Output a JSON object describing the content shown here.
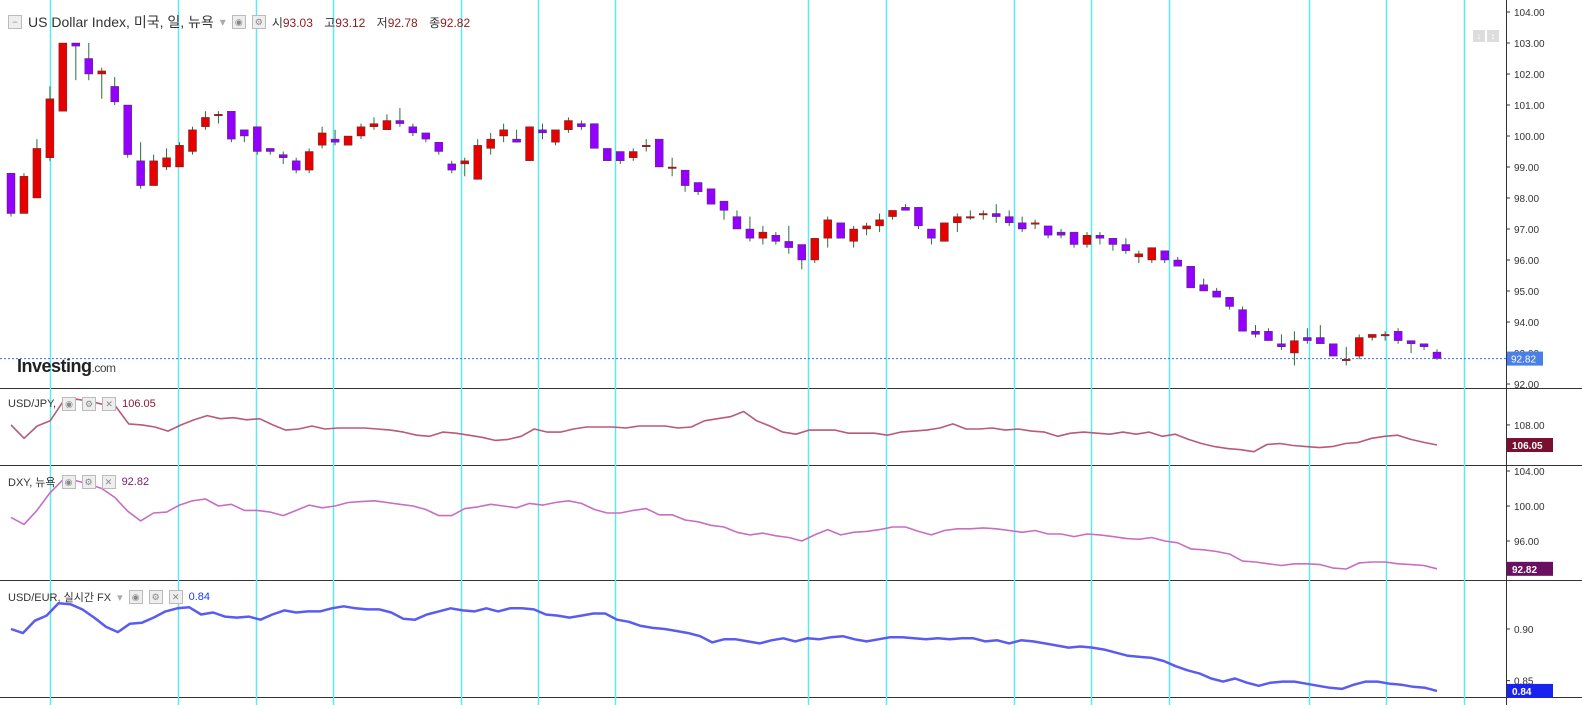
{
  "main": {
    "title": "US Dollar Index, 미국, 일, 뉴욕",
    "ohlc": [
      {
        "k": "시",
        "v": "93.03"
      },
      {
        "k": "고",
        "v": "93.12"
      },
      {
        "k": "저",
        "v": "92.78"
      },
      {
        "k": "종",
        "v": "92.82"
      }
    ],
    "last_label": "92.82",
    "logo_main": "Investing",
    "logo_suffix": ".com"
  },
  "panels": [
    {
      "title": "USD/JPY,",
      "value": "106.05",
      "value_color": "#8b1a3a",
      "last_label": "106.05",
      "label_bg": "#7a1030"
    },
    {
      "title": "DXY, 뉴욕",
      "value": "92.82",
      "value_color": "#7a1a6a",
      "last_label": "92.82",
      "label_bg": "#6b1060"
    },
    {
      "title": "USD/EUR, 실시간 FX",
      "value": "0.84",
      "value_color": "#1a3aff",
      "last_label": "0.84",
      "label_bg": "#1a22ee"
    }
  ],
  "colors": {
    "up": "#e60000",
    "down": "#9400ff",
    "wick": "#2c6e3c",
    "cyan_line": "#5ee8f0",
    "usdjpy": "#b85a78",
    "dxy": "#c86ec2",
    "usdeur": "#5a5cf0",
    "grid": "#eeeeee"
  },
  "chart_data": [
    {
      "type": "candlestick",
      "title": "US Dollar Index, 미국, 일, 뉴욕",
      "ylim": [
        92.0,
        104.0
      ],
      "y_ticks": [
        "104.00",
        "103.00",
        "102.00",
        "101.00",
        "100.00",
        "99.00",
        "98.00",
        "97.00",
        "96.00",
        "95.00",
        "94.00",
        "93.00",
        "92.00"
      ],
      "candles": [
        [
          98.8,
          98.8,
          97.4,
          97.5
        ],
        [
          97.5,
          98.8,
          97.5,
          98.7
        ],
        [
          98.0,
          99.9,
          98.0,
          99.6
        ],
        [
          99.3,
          101.6,
          99.2,
          101.2
        ],
        [
          100.8,
          103.0,
          100.8,
          103.0
        ],
        [
          103.0,
          103.0,
          101.8,
          102.9
        ],
        [
          102.5,
          103.0,
          101.8,
          102.0
        ],
        [
          102.0,
          102.2,
          101.2,
          102.1
        ],
        [
          101.6,
          101.9,
          101.0,
          101.1
        ],
        [
          101.0,
          101.0,
          99.3,
          99.4
        ],
        [
          99.2,
          99.8,
          98.3,
          98.4
        ],
        [
          98.4,
          99.4,
          98.4,
          99.2
        ],
        [
          99.0,
          99.6,
          98.9,
          99.3
        ],
        [
          99.0,
          99.8,
          99.0,
          99.7
        ],
        [
          99.5,
          100.3,
          99.4,
          100.2
        ],
        [
          100.3,
          100.8,
          100.2,
          100.6
        ],
        [
          100.7,
          100.8,
          100.4,
          100.7
        ],
        [
          100.8,
          100.8,
          99.8,
          99.9
        ],
        [
          100.2,
          100.2,
          99.8,
          100.0
        ],
        [
          100.3,
          100.3,
          99.4,
          99.5
        ],
        [
          99.6,
          99.6,
          99.4,
          99.5
        ],
        [
          99.4,
          99.5,
          99.1,
          99.3
        ],
        [
          99.2,
          99.3,
          98.8,
          98.9
        ],
        [
          98.9,
          99.6,
          98.8,
          99.5
        ],
        [
          99.7,
          100.3,
          99.6,
          100.1
        ],
        [
          99.9,
          100.2,
          99.7,
          99.8
        ],
        [
          99.7,
          100.0,
          99.7,
          100.0
        ],
        [
          100.0,
          100.4,
          99.9,
          100.3
        ],
        [
          100.3,
          100.6,
          100.2,
          100.4
        ],
        [
          100.2,
          100.7,
          100.2,
          100.5
        ],
        [
          100.5,
          100.9,
          100.3,
          100.4
        ],
        [
          100.3,
          100.4,
          100.0,
          100.1
        ],
        [
          100.1,
          100.1,
          99.8,
          99.9
        ],
        [
          99.8,
          99.8,
          99.4,
          99.5
        ],
        [
          99.1,
          99.2,
          98.8,
          98.9
        ],
        [
          99.1,
          99.3,
          98.7,
          99.2
        ],
        [
          98.6,
          99.9,
          98.6,
          99.7
        ],
        [
          99.6,
          100.1,
          99.4,
          99.9
        ],
        [
          100.0,
          100.4,
          99.8,
          100.2
        ],
        [
          99.9,
          100.2,
          99.8,
          99.8
        ],
        [
          99.2,
          100.3,
          99.2,
          100.3
        ],
        [
          100.2,
          100.4,
          99.9,
          100.1
        ],
        [
          99.8,
          99.9,
          99.7,
          100.2
        ],
        [
          100.2,
          100.6,
          100.1,
          100.5
        ],
        [
          100.4,
          100.5,
          100.2,
          100.3
        ],
        [
          100.4,
          100.4,
          99.6,
          99.6
        ],
        [
          99.6,
          99.6,
          99.2,
          99.2
        ],
        [
          99.5,
          99.5,
          99.1,
          99.2
        ],
        [
          99.3,
          99.6,
          99.2,
          99.5
        ],
        [
          99.7,
          99.9,
          99.5,
          99.7
        ],
        [
          99.9,
          99.9,
          99.0,
          99.0
        ],
        [
          99.0,
          99.3,
          98.7,
          99.0
        ],
        [
          98.9,
          98.9,
          98.2,
          98.4
        ],
        [
          98.5,
          98.5,
          98.1,
          98.2
        ],
        [
          98.3,
          98.3,
          97.8,
          97.8
        ],
        [
          97.9,
          97.9,
          97.3,
          97.6
        ],
        [
          97.4,
          97.6,
          97.0,
          97.0
        ],
        [
          97.0,
          97.4,
          96.6,
          96.7
        ],
        [
          96.7,
          97.1,
          96.5,
          96.9
        ],
        [
          96.8,
          96.9,
          96.5,
          96.6
        ],
        [
          96.6,
          97.1,
          96.2,
          96.4
        ],
        [
          96.5,
          96.5,
          95.7,
          96.0
        ],
        [
          96.0,
          96.7,
          95.9,
          96.7
        ],
        [
          96.7,
          97.4,
          96.4,
          97.3
        ],
        [
          97.2,
          97.2,
          96.8,
          96.7
        ],
        [
          96.6,
          97.1,
          96.4,
          97.0
        ],
        [
          97.0,
          97.2,
          96.8,
          97.1
        ],
        [
          97.1,
          97.5,
          96.9,
          97.3
        ],
        [
          97.4,
          97.6,
          97.3,
          97.6
        ],
        [
          97.7,
          97.8,
          97.6,
          97.6
        ],
        [
          97.7,
          97.7,
          97.0,
          97.1
        ],
        [
          97.0,
          97.0,
          96.5,
          96.7
        ],
        [
          96.6,
          97.2,
          96.6,
          97.2
        ],
        [
          97.2,
          97.5,
          96.9,
          97.4
        ],
        [
          97.4,
          97.6,
          97.3,
          97.4
        ],
        [
          97.5,
          97.6,
          97.3,
          97.5
        ],
        [
          97.5,
          97.8,
          97.2,
          97.4
        ],
        [
          97.4,
          97.6,
          97.1,
          97.2
        ],
        [
          97.2,
          97.4,
          96.9,
          97.0
        ],
        [
          97.2,
          97.3,
          97.0,
          97.2
        ],
        [
          97.1,
          97.1,
          96.7,
          96.8
        ],
        [
          96.9,
          97.0,
          96.7,
          96.8
        ],
        [
          96.9,
          96.9,
          96.4,
          96.5
        ],
        [
          96.5,
          96.9,
          96.4,
          96.8
        ],
        [
          96.8,
          96.9,
          96.5,
          96.7
        ],
        [
          96.7,
          96.7,
          96.3,
          96.5
        ],
        [
          96.5,
          96.7,
          96.2,
          96.3
        ],
        [
          96.1,
          96.3,
          95.9,
          96.2
        ],
        [
          96.0,
          96.4,
          95.9,
          96.4
        ],
        [
          96.3,
          96.3,
          95.9,
          96.0
        ],
        [
          96.0,
          96.1,
          95.8,
          95.8
        ],
        [
          95.8,
          95.8,
          95.1,
          95.1
        ],
        [
          95.2,
          95.4,
          95.0,
          95.0
        ],
        [
          95.0,
          95.1,
          94.8,
          94.8
        ],
        [
          94.8,
          94.8,
          94.4,
          94.5
        ],
        [
          94.4,
          94.5,
          93.7,
          93.7
        ],
        [
          93.7,
          93.9,
          93.5,
          93.6
        ],
        [
          93.7,
          93.8,
          93.5,
          93.4
        ],
        [
          93.3,
          93.6,
          93.1,
          93.2
        ],
        [
          93.0,
          93.7,
          92.6,
          93.4
        ],
        [
          93.5,
          93.8,
          93.3,
          93.4
        ],
        [
          93.5,
          93.9,
          93.3,
          93.3
        ],
        [
          93.3,
          93.3,
          92.9,
          92.9
        ],
        [
          92.8,
          93.2,
          92.6,
          92.8
        ],
        [
          92.9,
          93.6,
          92.8,
          93.5
        ],
        [
          93.5,
          93.6,
          93.4,
          93.6
        ],
        [
          93.6,
          93.7,
          93.4,
          93.6
        ],
        [
          93.7,
          93.8,
          93.3,
          93.4
        ],
        [
          93.4,
          93.4,
          93.0,
          93.3
        ],
        [
          93.3,
          93.3,
          93.1,
          93.2
        ],
        [
          93.03,
          93.12,
          92.78,
          92.82
        ]
      ]
    },
    {
      "type": "line",
      "title": "USD/JPY,",
      "ylim": [
        104.5,
        111.0
      ],
      "y_ticks": [
        "108.00"
      ],
      "series": [
        {
          "name": "USD/JPY",
          "values": [
            108.0,
            106.7,
            107.9,
            108.4,
            110.3,
            110.5,
            110.3,
            110.0,
            109.8,
            108.1,
            108.0,
            107.8,
            107.4,
            108.0,
            108.5,
            108.9,
            108.6,
            108.7,
            108.5,
            108.6,
            108.0,
            107.5,
            107.6,
            107.9,
            107.6,
            107.7,
            107.7,
            107.7,
            107.6,
            107.5,
            107.3,
            107.0,
            106.9,
            107.3,
            107.2,
            107.0,
            106.8,
            106.5,
            106.6,
            106.9,
            107.6,
            107.3,
            107.3,
            107.6,
            107.8,
            107.8,
            107.8,
            107.7,
            107.9,
            107.9,
            107.9,
            107.7,
            107.8,
            108.4,
            108.6,
            108.8,
            109.3,
            108.4,
            107.9,
            107.3,
            107.1,
            107.5,
            107.5,
            107.5,
            107.2,
            107.2,
            107.2,
            107.0,
            107.3,
            107.4,
            107.5,
            107.7,
            108.1,
            107.6,
            107.6,
            107.7,
            107.5,
            107.6,
            107.4,
            107.3,
            106.9,
            107.2,
            107.3,
            107.2,
            107.1,
            107.3,
            107.1,
            107.3,
            106.9,
            107.1,
            106.6,
            106.2,
            105.9,
            105.7,
            105.6,
            105.4,
            106.1,
            106.2,
            106.0,
            105.9,
            105.8,
            105.9,
            106.2,
            106.3,
            106.7,
            106.9,
            107.0,
            106.6,
            106.3,
            106.05
          ]
        }
      ]
    },
    {
      "type": "line",
      "title": "DXY, 뉴욕",
      "ylim": [
        92.0,
        104.0
      ],
      "y_ticks": [
        "104.00",
        "100.00",
        "96.00"
      ],
      "series": [
        {
          "name": "DXY",
          "values": [
            98.7,
            97.9,
            99.5,
            101.5,
            103.0,
            102.9,
            102.5,
            102.0,
            101.0,
            99.4,
            98.3,
            99.2,
            99.3,
            100.1,
            100.6,
            100.8,
            100.0,
            100.2,
            99.5,
            99.5,
            99.3,
            98.9,
            99.5,
            100.1,
            99.8,
            100.0,
            100.4,
            100.5,
            100.6,
            100.4,
            100.2,
            100.0,
            99.6,
            98.9,
            98.9,
            99.7,
            99.9,
            100.2,
            100.0,
            99.8,
            100.3,
            100.1,
            100.4,
            100.6,
            100.3,
            99.6,
            99.2,
            99.2,
            99.5,
            99.7,
            99.0,
            99.0,
            98.4,
            98.2,
            97.8,
            97.6,
            97.0,
            96.7,
            96.9,
            96.6,
            96.4,
            96.0,
            96.7,
            97.3,
            96.7,
            97.0,
            97.1,
            97.3,
            97.6,
            97.6,
            97.1,
            96.7,
            97.2,
            97.4,
            97.4,
            97.5,
            97.4,
            97.2,
            97.0,
            97.2,
            96.8,
            96.8,
            96.5,
            96.8,
            96.7,
            96.5,
            96.3,
            96.2,
            96.4,
            96.0,
            95.8,
            95.1,
            95.0,
            94.8,
            94.5,
            93.7,
            93.6,
            93.4,
            93.2,
            93.4,
            93.4,
            93.3,
            92.9,
            92.8,
            93.5,
            93.6,
            93.6,
            93.4,
            93.3,
            93.2,
            92.82
          ]
        }
      ]
    },
    {
      "type": "line",
      "title": "USD/EUR, 실시간 FX",
      "ylim": [
        0.838,
        0.93
      ],
      "y_ticks": [
        "0.90",
        "0.85"
      ],
      "series": [
        {
          "name": "USD/EUR",
          "values": [
            0.9,
            0.896,
            0.908,
            0.913,
            0.925,
            0.924,
            0.919,
            0.911,
            0.902,
            0.897,
            0.905,
            0.906,
            0.911,
            0.917,
            0.92,
            0.921,
            0.914,
            0.916,
            0.912,
            0.911,
            0.912,
            0.909,
            0.914,
            0.918,
            0.916,
            0.917,
            0.917,
            0.92,
            0.922,
            0.92,
            0.919,
            0.919,
            0.916,
            0.91,
            0.909,
            0.914,
            0.917,
            0.92,
            0.918,
            0.917,
            0.92,
            0.917,
            0.92,
            0.92,
            0.919,
            0.914,
            0.913,
            0.911,
            0.913,
            0.915,
            0.915,
            0.909,
            0.907,
            0.903,
            0.901,
            0.9,
            0.898,
            0.896,
            0.893,
            0.887,
            0.89,
            0.89,
            0.888,
            0.886,
            0.889,
            0.891,
            0.888,
            0.891,
            0.89,
            0.892,
            0.893,
            0.89,
            0.888,
            0.89,
            0.892,
            0.892,
            0.891,
            0.89,
            0.891,
            0.89,
            0.891,
            0.891,
            0.888,
            0.889,
            0.886,
            0.889,
            0.888,
            0.886,
            0.884,
            0.882,
            0.883,
            0.882,
            0.88,
            0.877,
            0.874,
            0.873,
            0.872,
            0.869,
            0.864,
            0.86,
            0.857,
            0.852,
            0.849,
            0.852,
            0.848,
            0.845,
            0.848,
            0.849,
            0.849,
            0.847,
            0.845,
            0.843,
            0.842,
            0.846,
            0.849,
            0.849,
            0.847,
            0.846,
            0.844,
            0.843,
            0.84
          ]
        }
      ]
    }
  ]
}
